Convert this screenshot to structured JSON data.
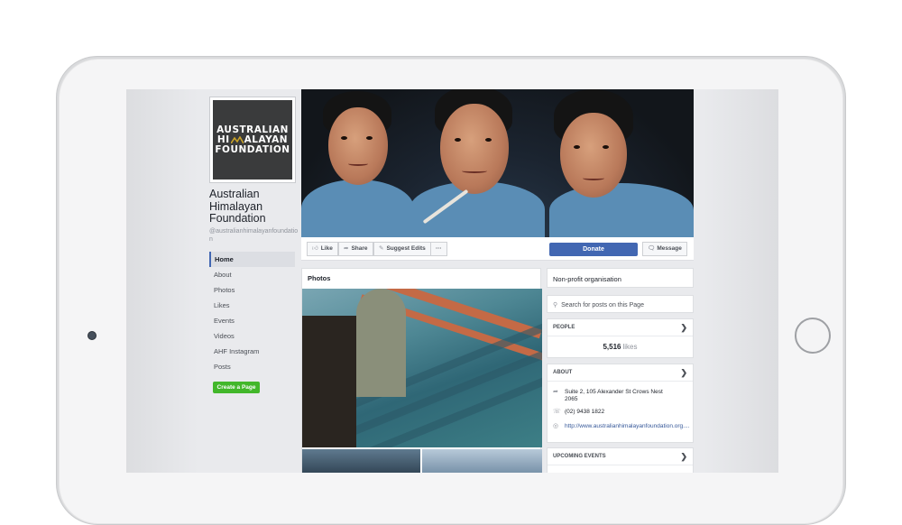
{
  "page": {
    "name": "Australian Himalayan Foundation",
    "handle": "@australianhimalayanfoundation",
    "logo": {
      "line1": "AUSTRALIAN",
      "line2a": "HI",
      "line2b": "ALAYAN",
      "line3": "FOUNDATION"
    }
  },
  "nav": [
    {
      "label": "Home",
      "active": true
    },
    {
      "label": "About"
    },
    {
      "label": "Photos"
    },
    {
      "label": "Likes"
    },
    {
      "label": "Events"
    },
    {
      "label": "Videos"
    },
    {
      "label": "AHF Instagram"
    },
    {
      "label": "Posts"
    }
  ],
  "create_page_label": "Create a Page",
  "actions": {
    "like": "Like",
    "share": "Share",
    "suggest": "Suggest Edits",
    "more": "···",
    "donate": "Donate",
    "message": "Message"
  },
  "photos": {
    "title": "Photos"
  },
  "sidebar": {
    "category": "Non-profit organisation",
    "search_placeholder": "Search for posts on this Page",
    "people": {
      "title": "PEOPLE",
      "likes_count": "5,516",
      "likes_label": "likes"
    },
    "about": {
      "title": "ABOUT",
      "address_line1": "Suite 2, 105 Alexander St Crows Nest",
      "address_line2": "2065",
      "phone": "(02) 9438 1822",
      "website": "http://www.australianhimalayanfoundation.org...."
    },
    "events": {
      "title": "UPCOMING EVENTS"
    }
  },
  "colors": {
    "facebook_blue": "#4267b2",
    "create_green": "#42b72a"
  }
}
